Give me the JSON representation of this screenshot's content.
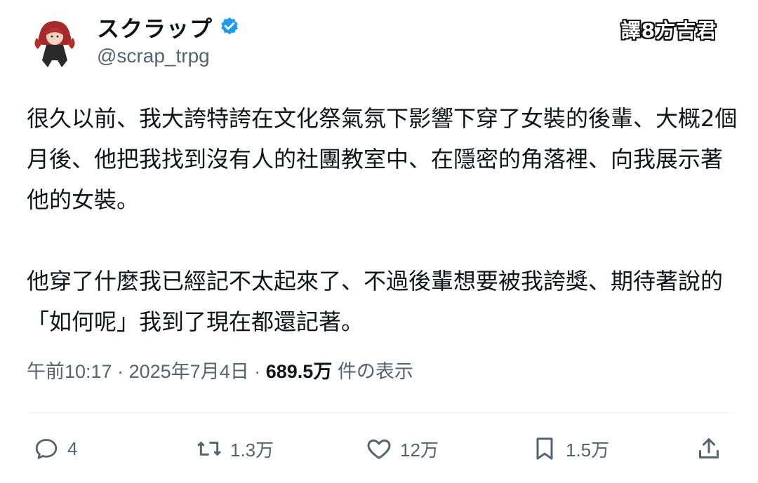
{
  "tweet": {
    "author_name": "スクラップ",
    "handle": "@scrap_trpg",
    "watermark": "譯8方吉君",
    "body_lines": [
      "很久以前、我大誇特誇在文化祭氣氛下影響下穿了女裝的後輩、大概2個月後、他把我找到沒有人的社團教室中、在隱密的角落裡、向我展示著他的女裝。",
      "他穿了什麼我已經記不太起來了、不過後輩想要被我誇獎、期待著說的「如何呢」我到了現在都還記著。"
    ],
    "time": "午前10:17",
    "date": "2025年7月4日",
    "separator": "·",
    "views_count": "689.5万",
    "views_label": "件の表示"
  },
  "actions": {
    "reply_count": "4",
    "retweet_count": "1.3万",
    "like_count": "12万",
    "bookmark_count": "1.5万"
  },
  "colors": {
    "verified_blue": "#1d9bf0",
    "secondary_text": "#536471",
    "primary_text": "#0f1419"
  },
  "icons": [
    "reply-icon",
    "retweet-icon",
    "like-icon",
    "bookmark-icon",
    "share-icon",
    "verified-badge-icon"
  ]
}
